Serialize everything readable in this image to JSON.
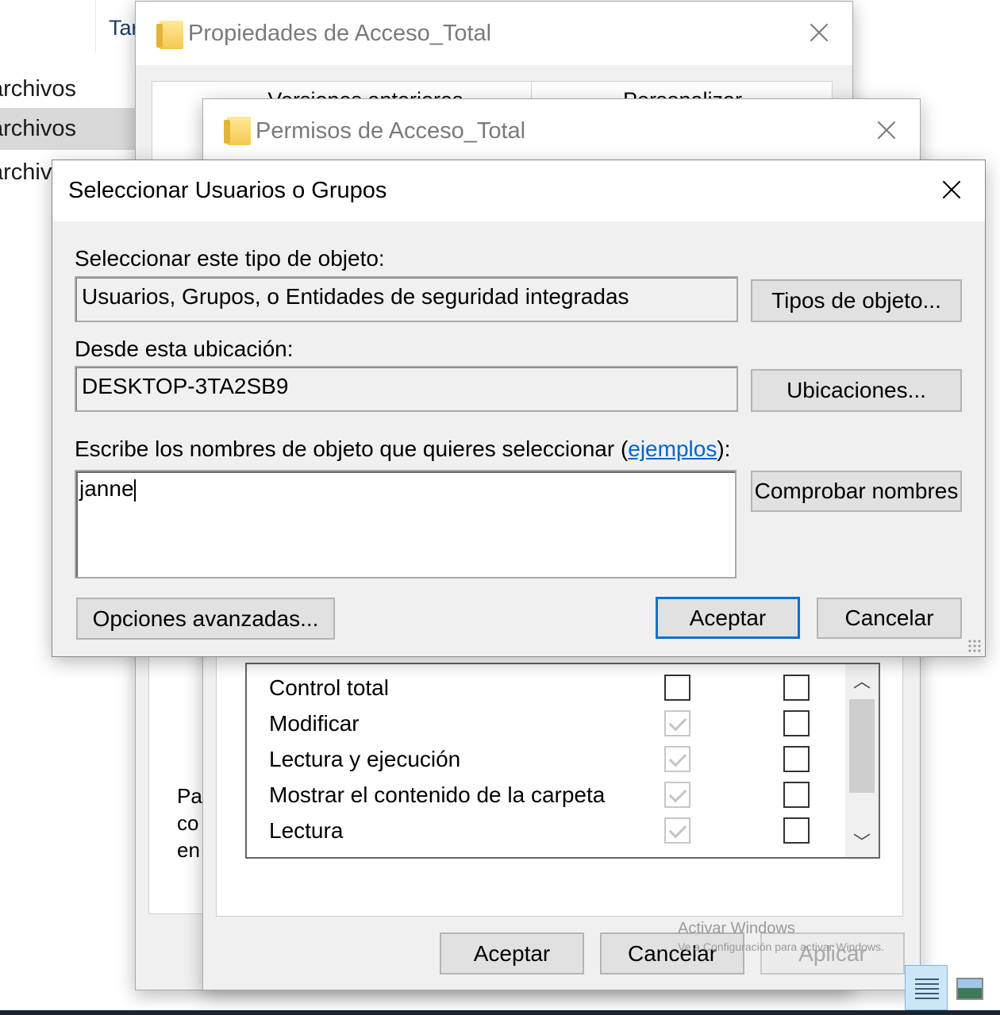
{
  "explorer": {
    "column_header": "Tar",
    "items": [
      {
        "label": "archivos"
      },
      {
        "label": "archivos"
      },
      {
        "label": "archivos"
      }
    ]
  },
  "properties_window": {
    "title": "Propiedades de Acceso_Total",
    "tabs": [
      "Versiones anteriores",
      "Personalizar"
    ],
    "partial_text": [
      "Pa",
      "co",
      "en"
    ]
  },
  "permissions_window": {
    "title": "Permisos de Acceso_Total",
    "permissions": [
      {
        "label": "Control total",
        "allow": false,
        "allow_disabled": false,
        "deny": false
      },
      {
        "label": "Modificar",
        "allow": true,
        "allow_disabled": true,
        "deny": false
      },
      {
        "label": "Lectura y ejecución",
        "allow": true,
        "allow_disabled": true,
        "deny": false
      },
      {
        "label": "Mostrar el contenido de la carpeta",
        "allow": true,
        "allow_disabled": true,
        "deny": false
      },
      {
        "label": "Lectura",
        "allow": true,
        "allow_disabled": true,
        "deny": false
      }
    ],
    "buttons": {
      "ok": "Aceptar",
      "cancel": "Cancelar",
      "apply": "Aplicar"
    },
    "watermark": {
      "line1": "Activar Windows",
      "line2": "Ve a Configuración para activar Windows."
    }
  },
  "select_dialog": {
    "title": "Seleccionar Usuarios o Grupos",
    "object_type_label": "Seleccionar este tipo de objeto:",
    "object_type_value": "Usuarios, Grupos, o Entidades de seguridad integradas",
    "object_types_button": "Tipos de objeto...",
    "location_label": "Desde esta ubicación:",
    "location_value": "DESKTOP-3TA2SB9",
    "locations_button": "Ubicaciones...",
    "names_label_prefix": "Escribe los nombres de objeto que quieres seleccionar (",
    "names_label_link": "ejemplos",
    "names_label_suffix": "):",
    "names_value": "janne",
    "check_names_button": "Comprobar nombres",
    "advanced_button": "Opciones avanzadas...",
    "ok_button": "Aceptar",
    "cancel_button": "Cancelar"
  }
}
